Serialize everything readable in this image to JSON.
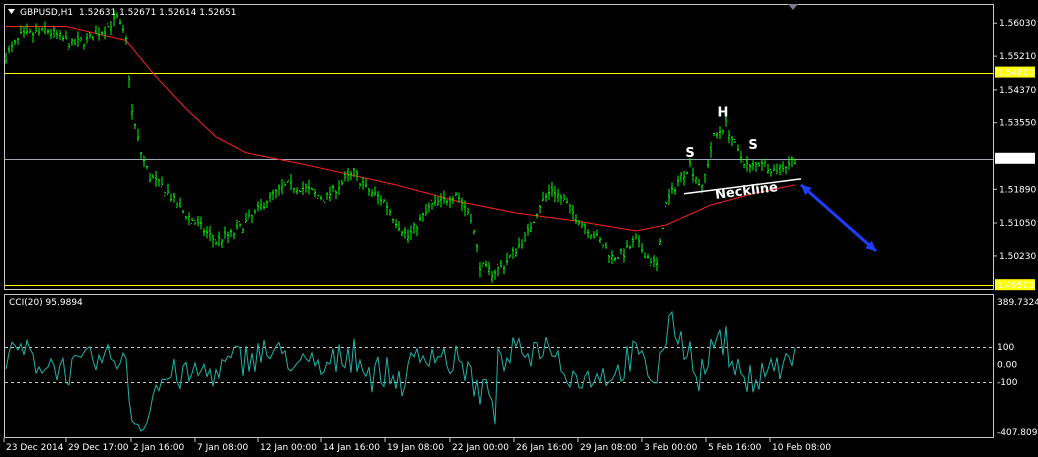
{
  "header": {
    "symbol": "GBPUSD,H1",
    "ohlc": "1.52631 1.52671 1.52614 1.52651"
  },
  "colors": {
    "background": "#000000",
    "price": "#00ff00",
    "ma": "#ff2020",
    "level": "#ffff00",
    "current": "#9aa8b8",
    "cci": "#20b2aa",
    "arrow": "#1e3cff"
  },
  "chart_data": [
    {
      "type": "line",
      "name": "price",
      "y_axis_ticks": [
        "1.56030",
        "1.55210",
        "1.54370",
        "1.53550",
        "1.52651",
        "1.51890",
        "1.51050",
        "1.50230",
        "1.49500"
      ],
      "levels": [
        {
          "label": "1.54800",
          "value": 1.548,
          "color": "#ffff00"
        },
        {
          "label": "1.49500",
          "value": 1.495,
          "color": "#ffff00"
        },
        {
          "label": "1.52651",
          "value": 1.52651,
          "color": "#9aa8b8"
        }
      ],
      "x_labels": [
        "23 Dec 2014",
        "29 Dec 17:00",
        "2 Jan 16:00",
        "7 Jan 08:00",
        "12 Jan 00:00",
        "14 Jan 16:00",
        "19 Jan 08:00",
        "22 Jan 00:00",
        "26 Jan 16:00",
        "29 Jan 08:00",
        "3 Feb 00:00",
        "5 Feb 16:00",
        "10 Feb 08:00"
      ],
      "ylim": [
        1.4943,
        1.5646
      ],
      "close_keypoints": [
        [
          0,
          1.552
        ],
        [
          5,
          1.557
        ],
        [
          14,
          1.5585
        ],
        [
          22,
          1.555
        ],
        [
          28,
          1.5565
        ],
        [
          33,
          1.5588
        ],
        [
          37,
          1.5615
        ],
        [
          40,
          1.556
        ],
        [
          42,
          1.538
        ],
        [
          45,
          1.528
        ],
        [
          48,
          1.522
        ],
        [
          53,
          1.519
        ],
        [
          58,
          1.514
        ],
        [
          64,
          1.51
        ],
        [
          70,
          1.506
        ],
        [
          76,
          1.508
        ],
        [
          82,
          1.512
        ],
        [
          88,
          1.517
        ],
        [
          94,
          1.52
        ],
        [
          100,
          1.519
        ],
        [
          106,
          1.5165
        ],
        [
          112,
          1.5205
        ],
        [
          116,
          1.523
        ],
        [
          120,
          1.519
        ],
        [
          126,
          1.516
        ],
        [
          130,
          1.511
        ],
        [
          134,
          1.507
        ],
        [
          138,
          1.511
        ],
        [
          142,
          1.515
        ],
        [
          146,
          1.516
        ],
        [
          150,
          1.518
        ],
        [
          155,
          1.512
        ],
        [
          158,
          1.5
        ],
        [
          162,
          1.498
        ],
        [
          166,
          1.5
        ],
        [
          170,
          1.504
        ],
        [
          174,
          1.508
        ],
        [
          178,
          1.515
        ],
        [
          182,
          1.519
        ],
        [
          186,
          1.516
        ],
        [
          190,
          1.512
        ],
        [
          194,
          1.509
        ],
        [
          198,
          1.506
        ],
        [
          202,
          1.502
        ],
        [
          206,
          1.503
        ],
        [
          210,
          1.506
        ],
        [
          214,
          1.502
        ],
        [
          217,
          1.5
        ],
        [
          220,
          1.515
        ],
        [
          224,
          1.521
        ],
        [
          228,
          1.525
        ],
        [
          232,
          1.519
        ],
        [
          236,
          1.532
        ],
        [
          240,
          1.535
        ],
        [
          244,
          1.528
        ],
        [
          248,
          1.524
        ],
        [
          252,
          1.526
        ],
        [
          256,
          1.5235
        ],
        [
          260,
          1.525
        ],
        [
          263,
          1.5265
        ]
      ],
      "ma_keypoints": [
        [
          0,
          1.5595
        ],
        [
          20,
          1.5595
        ],
        [
          40,
          1.556
        ],
        [
          50,
          1.547
        ],
        [
          60,
          1.539
        ],
        [
          70,
          1.532
        ],
        [
          80,
          1.528
        ],
        [
          100,
          1.525
        ],
        [
          130,
          1.52
        ],
        [
          150,
          1.516
        ],
        [
          170,
          1.513
        ],
        [
          190,
          1.511
        ],
        [
          210,
          1.5085
        ],
        [
          220,
          1.51
        ],
        [
          235,
          1.515
        ],
        [
          250,
          1.518
        ],
        [
          263,
          1.52
        ]
      ],
      "annotations": [
        {
          "text": "S",
          "x": 228,
          "y": 1.527
        },
        {
          "text": "H",
          "x": 239,
          "y": 1.537
        },
        {
          "text": "S",
          "x": 249,
          "y": 1.529
        },
        {
          "text": "Neckline",
          "x": 247,
          "y": 1.519
        }
      ],
      "neckline": [
        [
          226,
          1.5178
        ],
        [
          265,
          1.5215
        ]
      ],
      "projection_arrow": [
        [
          265,
          1.52
        ],
        [
          290,
          1.5035
        ]
      ]
    },
    {
      "type": "line",
      "name": "CCI(20) 95.9894",
      "y_axis_ticks": [
        "389.7324",
        "100",
        "0.00",
        "-100",
        "-407.8091"
      ],
      "ylim": [
        -407.8091,
        389.7324
      ],
      "dashed_levels": [
        100,
        -100
      ],
      "last_value": 95.9894
    }
  ]
}
